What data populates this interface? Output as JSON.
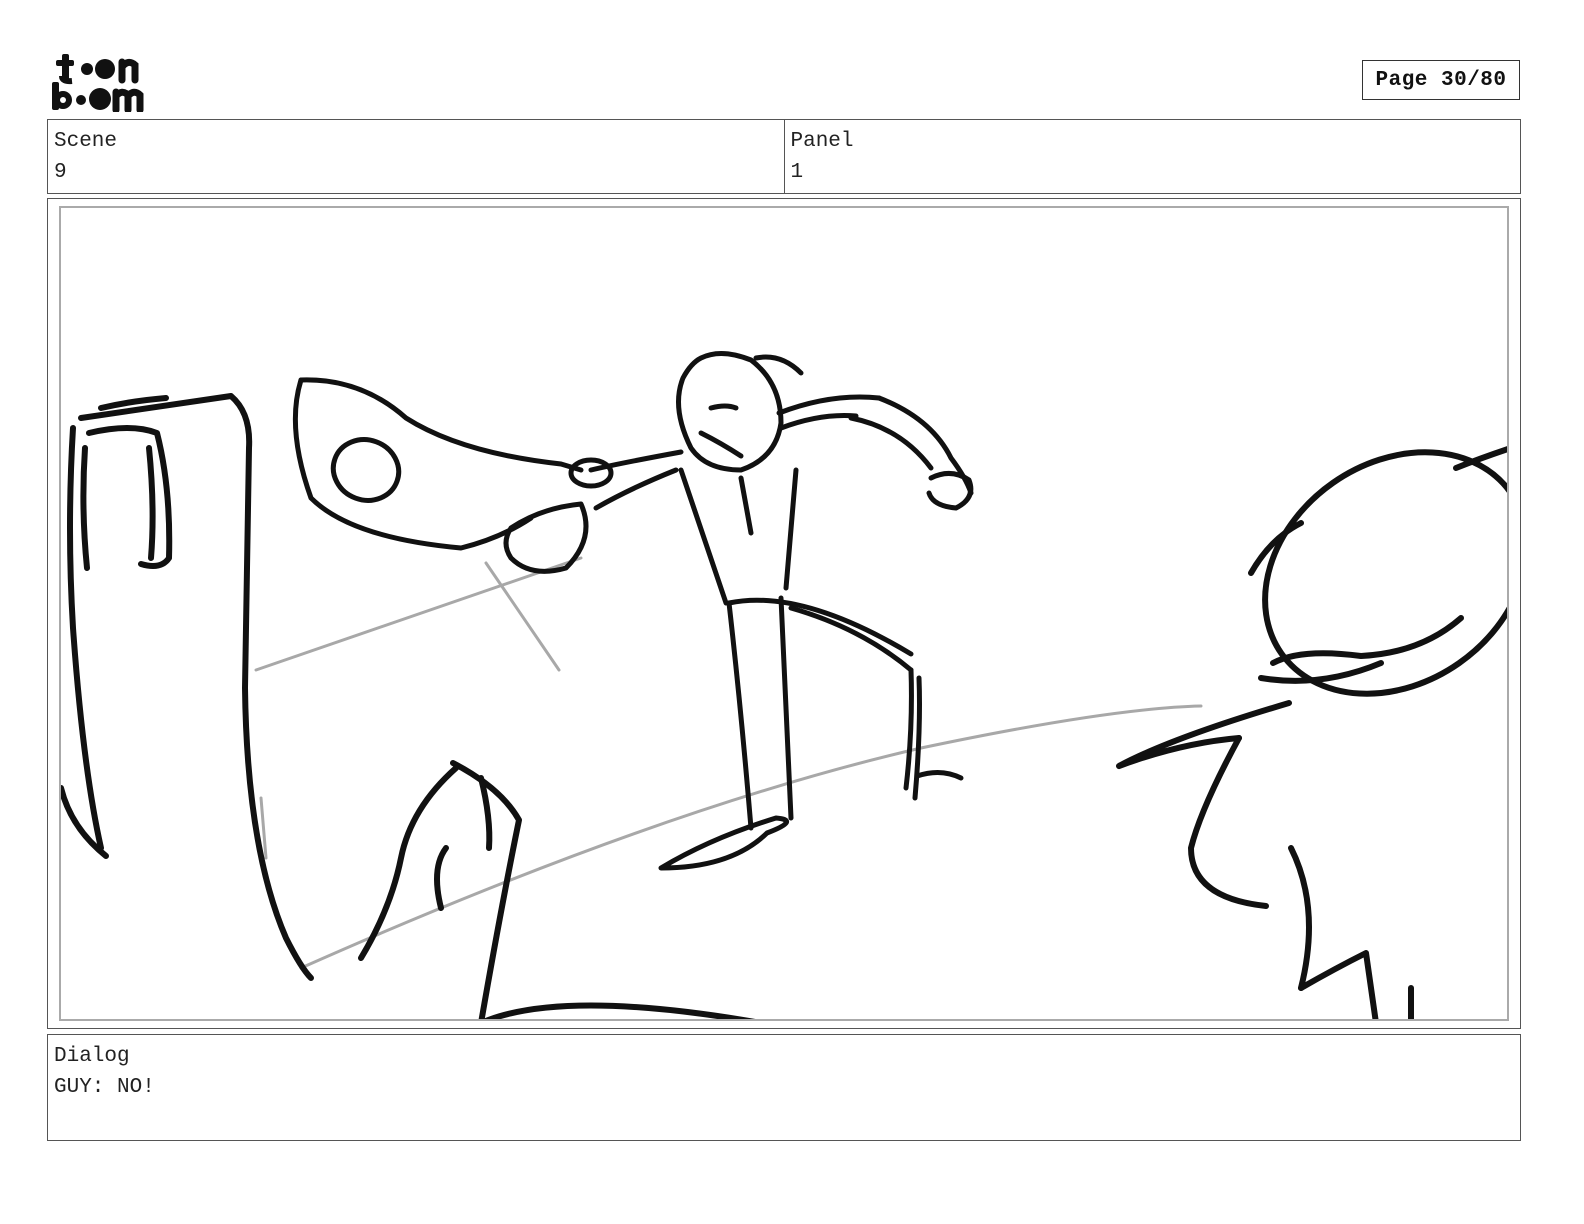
{
  "header": {
    "logo_text": "toonboom",
    "page_label": "Page 30/80"
  },
  "info": {
    "scene_label": "Scene",
    "scene_value": "9",
    "panel_label": "Panel",
    "panel_value": "1"
  },
  "dialog": {
    "label": "Dialog",
    "text": "GUY: NO!"
  },
  "colors": {
    "ink": "#111111",
    "guide": "#a8a8a8",
    "border": "#555555"
  }
}
